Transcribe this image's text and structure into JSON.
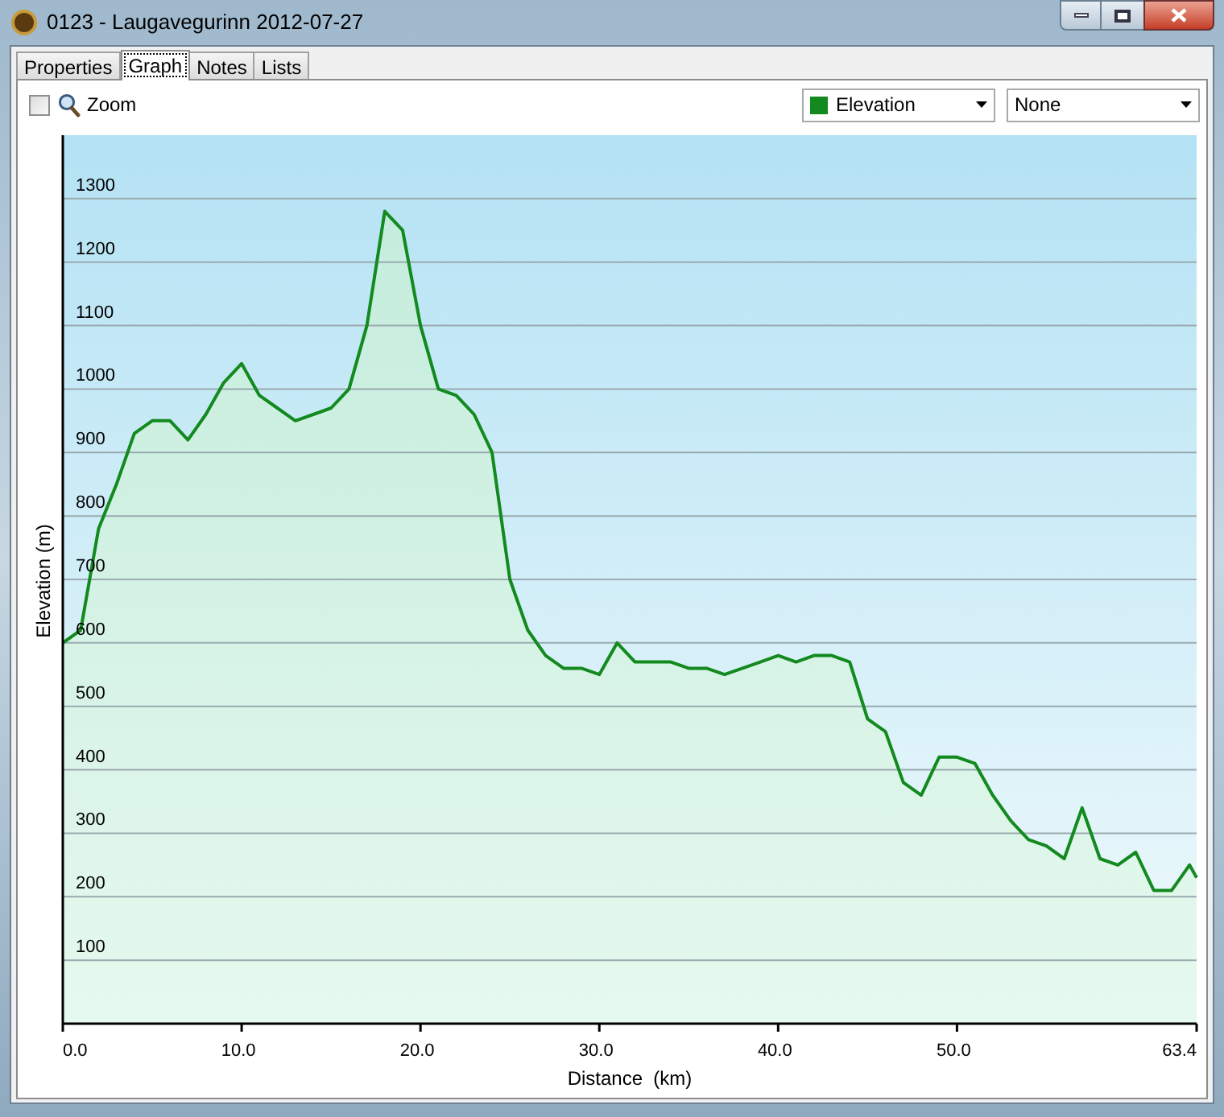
{
  "window": {
    "title": "0123 - Laugavegurinn 2012-07-27"
  },
  "tabs": [
    {
      "label": "Properties",
      "selected": false
    },
    {
      "label": "Graph",
      "selected": true
    },
    {
      "label": "Notes",
      "selected": false
    },
    {
      "label": "Lists",
      "selected": false
    }
  ],
  "toolbar": {
    "zoom": {
      "label": "Zoom",
      "checked": false
    },
    "second_select": {
      "value": "None"
    }
  },
  "graph": {
    "chart_data": {
      "type": "area",
      "xlabel": "Distance  (km)",
      "ylabel": "Elevation (m)",
      "x": [
        0,
        1,
        2,
        3,
        4,
        5,
        6,
        7,
        8,
        9,
        10,
        11,
        12,
        13,
        14,
        15,
        16,
        17,
        18,
        19,
        20,
        21,
        22,
        23,
        24,
        25,
        26,
        27,
        28,
        29,
        30,
        31,
        32,
        33,
        34,
        35,
        36,
        37,
        38,
        39,
        40,
        41,
        42,
        43,
        44,
        45,
        46,
        47,
        48,
        49,
        50,
        51,
        52,
        53,
        54,
        55,
        56,
        57,
        58,
        59,
        60,
        61,
        62,
        63,
        63.4
      ],
      "series": [
        {
          "name": "Elevation",
          "color": "#138a1f",
          "values": [
            600,
            620,
            780,
            850,
            930,
            950,
            950,
            920,
            960,
            1010,
            1040,
            990,
            970,
            950,
            960,
            970,
            1000,
            1100,
            1280,
            1250,
            1100,
            1000,
            990,
            960,
            900,
            700,
            620,
            580,
            560,
            560,
            550,
            600,
            570,
            570,
            570,
            560,
            560,
            550,
            560,
            570,
            580,
            570,
            580,
            580,
            570,
            480,
            460,
            380,
            360,
            420,
            420,
            410,
            360,
            320,
            290,
            280,
            260,
            340,
            260,
            250,
            270,
            210,
            210,
            250,
            230
          ]
        }
      ],
      "xlim": [
        0,
        63.4
      ],
      "ylim": [
        0,
        1400
      ],
      "grid": true,
      "xticks": [
        {
          "value": 0,
          "label": "0.0"
        },
        {
          "value": 10,
          "label": "10.0"
        },
        {
          "value": 20,
          "label": "20.0"
        },
        {
          "value": 30,
          "label": "30.0"
        },
        {
          "value": 40,
          "label": "40.0"
        },
        {
          "value": 50,
          "label": "50.0"
        },
        {
          "value": 63.4,
          "label": "63.4"
        }
      ],
      "yticks": [
        100,
        200,
        300,
        400,
        500,
        600,
        700,
        800,
        900,
        1000,
        1100,
        1200,
        1300
      ]
    }
  }
}
